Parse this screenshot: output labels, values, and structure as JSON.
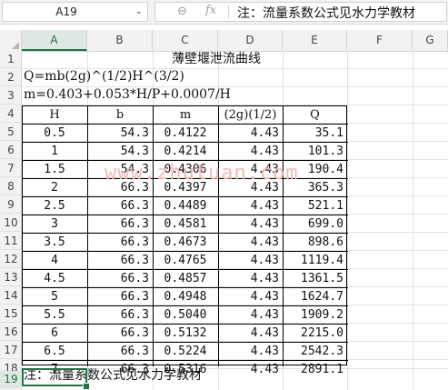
{
  "formula_bar": {
    "name_box": "A19",
    "name_box_arrow": "⌄",
    "zoom_icon": "⊖",
    "fx_icon": "fx",
    "content": "注：流量系数公式见水力学教材"
  },
  "columns": [
    "A",
    "B",
    "C",
    "D",
    "E",
    "F",
    "G"
  ],
  "rows": [
    "1",
    "2",
    "3",
    "4",
    "5",
    "6",
    "7",
    "8",
    "9",
    "10",
    "11",
    "12",
    "13",
    "14",
    "15",
    "16",
    "17",
    "18",
    "19"
  ],
  "sheet": {
    "title": "薄壁堰泄流曲线",
    "formula_q": "Q=mb(2g)^(1/2)H^(3/2)",
    "formula_m": "m=0.403+0.053*H/P+0.0007/H",
    "headers": [
      "H",
      "b",
      "m",
      "(2g)(1/2)",
      "Q"
    ],
    "table": [
      [
        "0.5",
        "54.3",
        "0.4122",
        "4.43",
        "35.1"
      ],
      [
        "1",
        "54.3",
        "0.4214",
        "4.43",
        "101.3"
      ],
      [
        "1.5",
        "54.3",
        "0.4306",
        "4.43",
        "190.4"
      ],
      [
        "2",
        "66.3",
        "0.4397",
        "4.43",
        "365.3"
      ],
      [
        "2.5",
        "66.3",
        "0.4489",
        "4.43",
        "521.1"
      ],
      [
        "3",
        "66.3",
        "0.4581",
        "4.43",
        "699.0"
      ],
      [
        "3.5",
        "66.3",
        "0.4673",
        "4.43",
        "898.6"
      ],
      [
        "4",
        "66.3",
        "0.4765",
        "4.43",
        "1119.4"
      ],
      [
        "4.5",
        "66.3",
        "0.4857",
        "4.43",
        "1361.5"
      ],
      [
        "5",
        "66.3",
        "0.4948",
        "4.43",
        "1624.7"
      ],
      [
        "5.5",
        "66.3",
        "0.5040",
        "4.43",
        "1909.2"
      ],
      [
        "6",
        "66.3",
        "0.5132",
        "4.43",
        "2215.0"
      ],
      [
        "6.5",
        "66.3",
        "0.5224",
        "4.43",
        "2542.3"
      ],
      [
        "7",
        "66.3",
        "0.5316",
        "4.43",
        "2891.1"
      ]
    ],
    "note": "注：流量系数公式见水力学教材",
    "watermark": "www.zhutuan.com"
  },
  "colors": {
    "accent": "#217346",
    "watermark": "#f5b8b8"
  }
}
